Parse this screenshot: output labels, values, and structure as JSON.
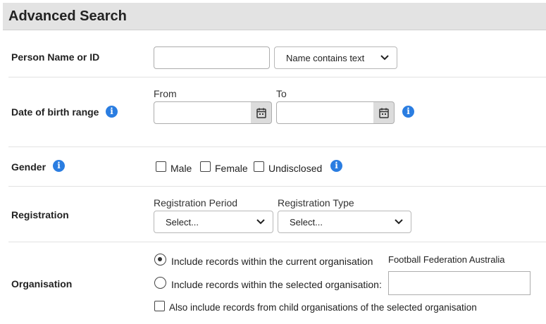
{
  "header": {
    "title": "Advanced Search"
  },
  "person": {
    "label": "Person Name or ID",
    "input_value": "",
    "match_mode": "Name contains text"
  },
  "dob": {
    "label": "Date of birth range",
    "from_label": "From",
    "to_label": "To",
    "from_value": "",
    "to_value": ""
  },
  "gender": {
    "label": "Gender",
    "options": [
      {
        "label": "Male",
        "checked": false
      },
      {
        "label": "Female",
        "checked": false
      },
      {
        "label": "Undisclosed",
        "checked": false
      }
    ]
  },
  "registration": {
    "label": "Registration",
    "period_label": "Registration Period",
    "period_value": "Select...",
    "type_label": "Registration Type",
    "type_value": "Select..."
  },
  "organisation": {
    "label": "Organisation",
    "option_current": "Include records within the current organisation",
    "current_org_name": "Football Federation Australia",
    "option_selected": "Include records within the selected organisation:",
    "selected_org_value": "",
    "include_children": "Also include records from child organisations of the selected organisation",
    "selected_radio": "current"
  },
  "colors": {
    "accent": "#2a7de1",
    "header_bg": "#e3e3e3"
  },
  "icons": {
    "info": "info-icon",
    "calendar": "calendar-icon",
    "chevron": "chevron-down-icon"
  }
}
